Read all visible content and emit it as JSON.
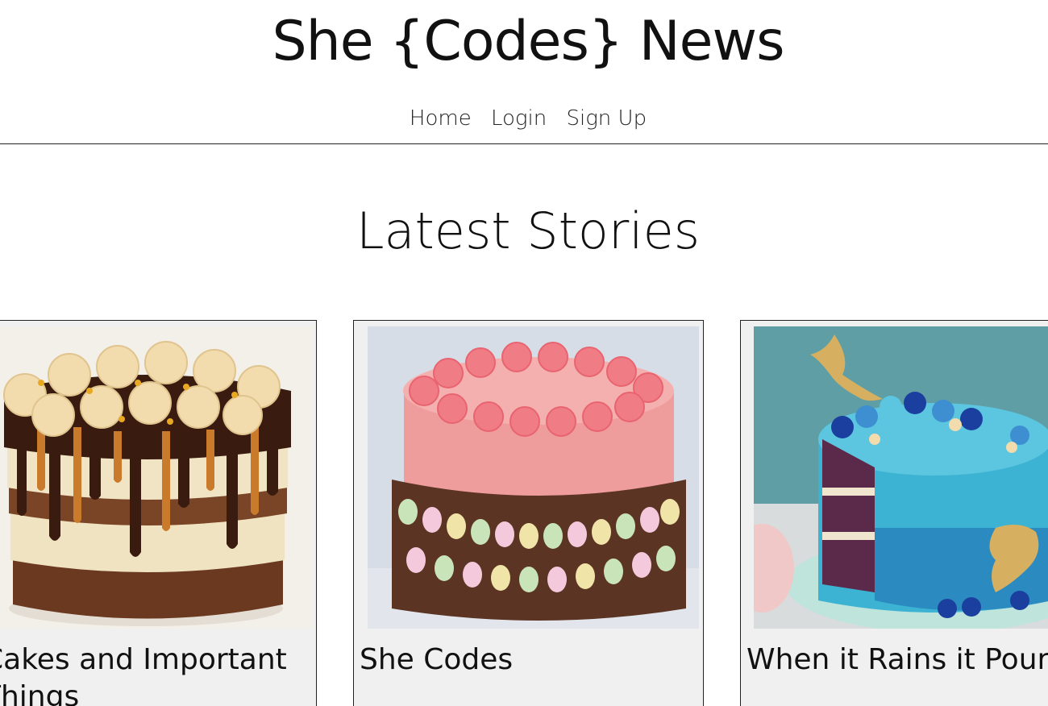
{
  "site": {
    "title": "She {Codes} News"
  },
  "nav": {
    "items": [
      {
        "label": "Home"
      },
      {
        "label": "Login"
      },
      {
        "label": "Sign Up"
      }
    ]
  },
  "main": {
    "heading": "Latest Stories",
    "stories": [
      {
        "title": "Cakes and Important Things",
        "image": "chocolate-drip-cake-image"
      },
      {
        "title": "She Codes",
        "image": "pink-cake-image"
      },
      {
        "title": "When it Rains it Pours",
        "image": "mermaid-cake-image"
      }
    ]
  },
  "colors": {
    "card_background": "#f0f0f0",
    "border": "#222222",
    "text": "#111111"
  }
}
